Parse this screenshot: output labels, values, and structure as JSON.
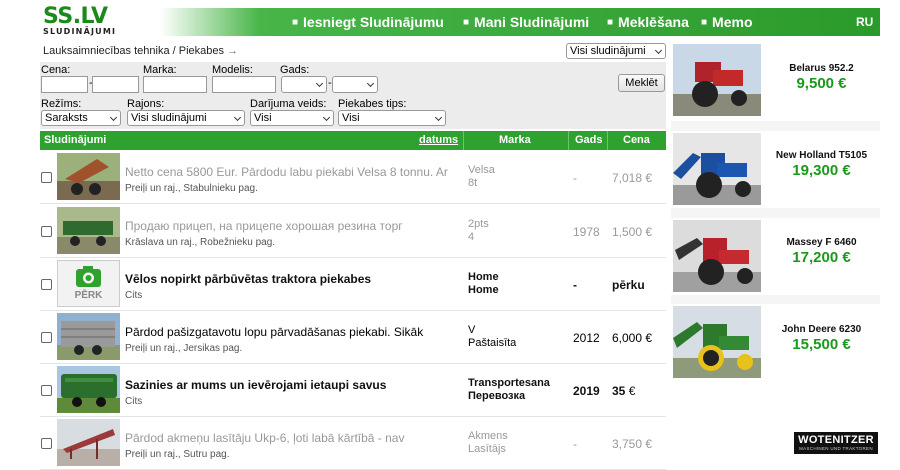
{
  "logo": {
    "text": "SS.LV",
    "subtitle": "SLUDINĀJUMI"
  },
  "nav": {
    "items": [
      "Iesniegt Sludinājumu",
      "Mani Sludinājumi",
      "Meklēšana",
      "Memo"
    ],
    "lang": "RU",
    "bullet": "■"
  },
  "breadcrumb": {
    "path": "Lauksaimniecības tehnika / Piekabes",
    "arrow": "→"
  },
  "view_select": "Visi sludinājumi",
  "filters": {
    "cena_label": "Cena:",
    "marka_label": "Marka:",
    "modelis_label": "Modelis:",
    "gads_label": "Gads:",
    "dash": "-",
    "search_button": "Meklēt",
    "rezims_label": "Režīms:",
    "rezims_value": "Saraksts",
    "rajons_label": "Rajons:",
    "rajons_value": "Visi sludinājumi",
    "darijuma_label": "Darījuma veids:",
    "darijuma_value": "Visi",
    "tips_label": "Piekabes tips:",
    "tips_value": "Visi"
  },
  "table": {
    "headers": {
      "sludinajumi": "Sludinājumi",
      "datums": "datums",
      "marka": "Marka",
      "gads": "Gads",
      "cena": "Cena"
    },
    "rows": [
      {
        "title": "Netto cena 5800 Eur. Pārdodu labu piekabi Velsa 8 tonnu. Ar",
        "location": "Preiļi un raj., Stabulnieku pag.",
        "marka1": "Velsa",
        "marka2": "8t",
        "gads": "-",
        "cena": "7,018 €",
        "style": "gray"
      },
      {
        "title": "Продаю прицеп, на прицепе хорошая резина торг",
        "location": "Krāslava un raj., Robežnieku pag.",
        "marka1": "2pts",
        "marka2": "4",
        "gads": "1978",
        "cena": "1,500 €",
        "style": "gray"
      },
      {
        "title": "Vēlos nopirkt pārbūvētas traktora piekabes",
        "location": "Cits",
        "marka1": "Home",
        "marka2": "Home",
        "gads": "-",
        "cena": "pērku",
        "style": "strong"
      },
      {
        "title": "Pārdod pašizgatavotu lopu pārvadāšanas piekabi. Sikāk",
        "location": "Preiļi un raj., Jersikas pag.",
        "marka1": "V",
        "marka2": "Paštaisīta",
        "gads": "2012",
        "cena": "6,000 €",
        "style": "normal"
      },
      {
        "title": "Sazinies ar mums un ievērojami ietaupi savus",
        "location": "Cits",
        "marka1": "Transportesana",
        "marka2": "Перевозка",
        "gads": "2019",
        "cena": "35",
        "cena_unit": "€",
        "style": "strong"
      },
      {
        "title": "Pārdod akmeņu lasītāju Ukp-6, ļoti labā kārtībā - nav",
        "location": "Preiļi un raj., Sutru pag.",
        "marka1": "Akmens",
        "marka2": "Lasītājs",
        "gads": "-",
        "cena": "3,750 €",
        "style": "gray"
      }
    ],
    "no_photo_label": "PĒRK"
  },
  "ads": {
    "items": [
      {
        "name": "Belarus 952.2",
        "price": "9,500 €"
      },
      {
        "name": "New Holland T5105",
        "price": "19,300 €"
      },
      {
        "name": "Massey F 6460",
        "price": "17,200 €"
      },
      {
        "name": "John Deere 6230",
        "price": "15,500 €"
      }
    ],
    "brand": "WOTENITZER",
    "brand_sub": "MASCHINEN UND TRAKTOREN",
    "close": "✕",
    "info": "i"
  },
  "colors": {
    "brand_green": "#2fa12f",
    "price_green": "#1a9a1a"
  }
}
